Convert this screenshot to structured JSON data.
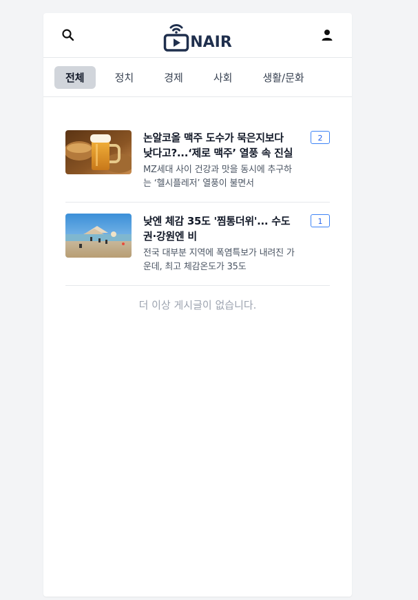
{
  "header": {
    "logo_text": "NAIR",
    "search_icon": "search-icon",
    "user_icon": "user-icon"
  },
  "tabs": [
    {
      "label": "전체",
      "active": true
    },
    {
      "label": "정치",
      "active": false
    },
    {
      "label": "경제",
      "active": false
    },
    {
      "label": "사회",
      "active": false
    },
    {
      "label": "생활/문화",
      "active": false
    }
  ],
  "articles": [
    {
      "title": "논알코올 맥주 도수가 묵은지보다 낮다고?...‘제로 맥주’ 열풍 속 진실",
      "summary": "MZ세대 사이 건강과 맛을 동시에 추구하는 ‘헬시플레저’ 열풍이 불면서",
      "count": "2",
      "thumbnail": "beer-mug-image"
    },
    {
      "title": "낮엔 체감 35도 '찜통더위'... 수도권·강원엔 비",
      "summary": "전국 대부분 지역에 폭염특보가 내려진 가운데, 최고 체감온도가 35도",
      "count": "1",
      "thumbnail": "beach-image"
    }
  ],
  "end_message": "더 이상 게시글이 없습니다.",
  "colors": {
    "accent": "#2563eb",
    "logo": "#1f2f4d",
    "active_tab_bg": "#d1d5db"
  }
}
